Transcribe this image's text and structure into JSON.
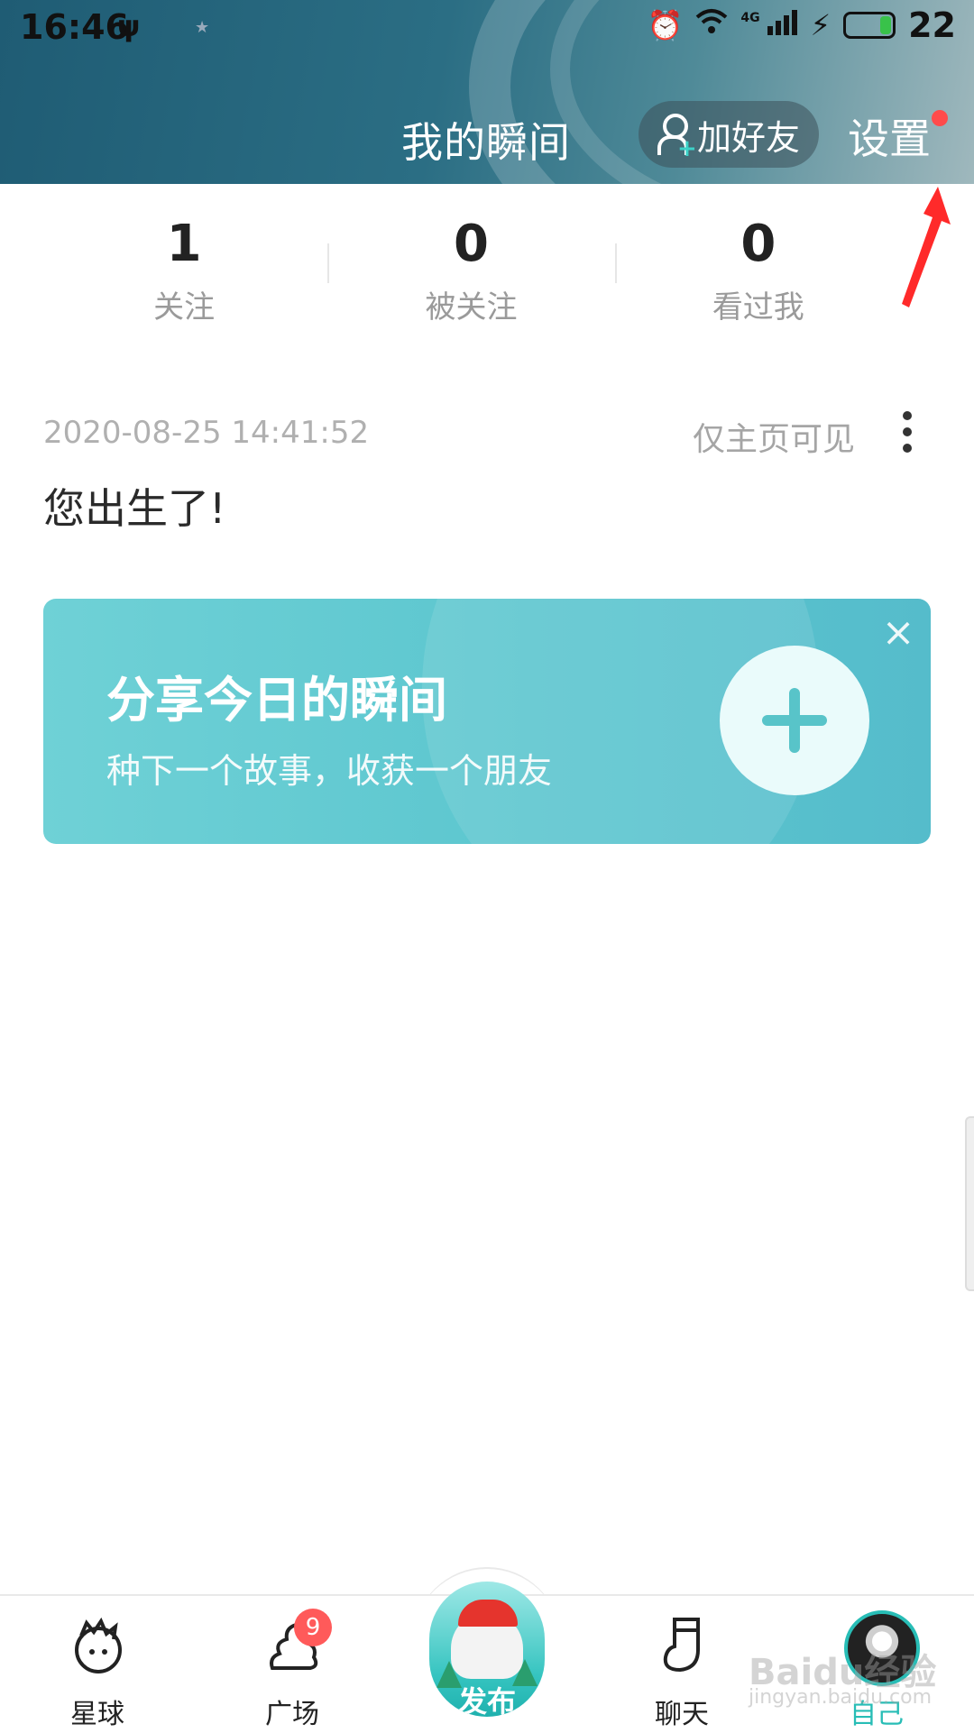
{
  "status_bar": {
    "time": "16:46",
    "network": "4G",
    "battery": "22"
  },
  "header": {
    "title": "我的瞬间",
    "add_friend_label": "加好友",
    "settings_label": "设置"
  },
  "stats": [
    {
      "value": "1",
      "label": "关注"
    },
    {
      "value": "0",
      "label": "被关注"
    },
    {
      "value": "0",
      "label": "看过我"
    }
  ],
  "post": {
    "timestamp": "2020-08-25 14:41:52",
    "visibility": "仅主页可见",
    "content": "您出生了!"
  },
  "banner": {
    "title": "分享今日的瞬间",
    "subtitle": "种下一个故事，收获一个朋友"
  },
  "bottom_nav": {
    "items": [
      {
        "label": "星球"
      },
      {
        "label": "广场",
        "badge": "9"
      },
      {
        "label": "发布"
      },
      {
        "label": "聊天"
      },
      {
        "label": "自己"
      }
    ]
  },
  "watermark": {
    "text": "Baidu经验",
    "sub": "jingyan.baidu.com"
  },
  "colors": {
    "accent": "#28bdb6",
    "banner": "#5cc6cf",
    "badge": "#ff5a5a",
    "annotation_arrow": "#ff2a2a"
  }
}
